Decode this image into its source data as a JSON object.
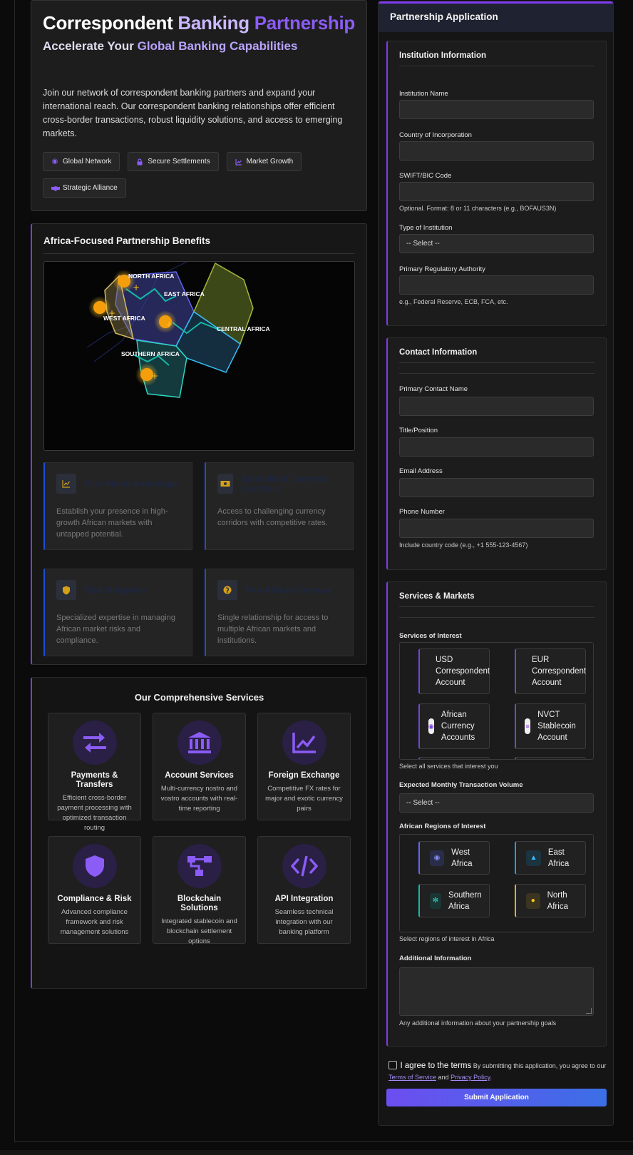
{
  "hero": {
    "title_w1": "Correspondent ",
    "title_w2": "Banking ",
    "title_w3": "Partnership",
    "subtitle_w1": "Accelerate Your ",
    "subtitle_w2": "Global Banking Capabilities",
    "description": "Join our network of correspondent banking partners and expand your international reach. Our correspondent banking relationships offer efficient cross-border transactions, robust liquidity solutions, and access to emerging markets.",
    "tags": [
      {
        "label": "Global Network",
        "icon": "globe-icon"
      },
      {
        "label": "Secure Settlements",
        "icon": "lock-icon"
      },
      {
        "label": "Market Growth",
        "icon": "chart-line-icon"
      },
      {
        "label": "Strategic Alliance",
        "icon": "handshake-icon"
      }
    ]
  },
  "benefits": {
    "title": "Africa-Focused Partnership Benefits",
    "map_labels": {
      "north": "NORTH AFRICA",
      "east": "EAST AFRICA",
      "west": "WEST AFRICA",
      "central": "CENTRAL AFRICA",
      "southern": "SOUTHERN AFRICA"
    },
    "cards": [
      {
        "title": "First-Mover Advantage",
        "text": "Establish your presence in high-growth African markets with untapped potential.",
        "icon": "chart-line-icon"
      },
      {
        "title": "Specialized Currency Corridors",
        "text": "Access to challenging currency corridors with competitive rates.",
        "icon": "money-bill-icon"
      },
      {
        "title": "Risk Mitigation",
        "text": "Specialized expertise in managing African market risks and compliance.",
        "icon": "shield-icon"
      },
      {
        "title": "Pan-African Gateway",
        "text": "Single relationship for access to multiple African markets and institutions.",
        "icon": "globe-africa-icon"
      }
    ]
  },
  "services": {
    "title": "Our Comprehensive Services",
    "items": [
      {
        "title": "Payments & Transfers",
        "text": "Efficient cross-border payment processing with optimized transaction routing"
      },
      {
        "title": "Account Services",
        "text": "Multi-currency nostro and vostro accounts with real-time reporting"
      },
      {
        "title": "Foreign Exchange",
        "text": "Competitive FX rates for major and exotic currency pairs"
      },
      {
        "title": "Compliance & Risk",
        "text": "Advanced compliance framework and risk management solutions"
      },
      {
        "title": "Blockchain Solutions",
        "text": "Integrated stablecoin and blockchain settlement options"
      },
      {
        "title": "API Integration",
        "text": "Seamless technical integration with our banking platform"
      }
    ]
  },
  "form": {
    "header": "Partnership Application",
    "institution": {
      "title": "Institution Information",
      "name_label": "Institution Name",
      "country_label": "Country of Incorporation",
      "swift_label": "SWIFT/BIC Code",
      "swift_hint": "Optional. Format: 8 or 11 characters (e.g., BOFAUS3N)",
      "type_label": "Type of Institution",
      "type_value": "-- Select --",
      "regulator_label": "Primary Regulatory Authority",
      "regulator_hint": "e.g., Federal Reserve, ECB, FCA, etc."
    },
    "contact": {
      "title": "Contact Information",
      "name_label": "Primary Contact Name",
      "title_label": "Title/Position",
      "email_label": "Email Address",
      "phone_label": "Phone Number",
      "phone_hint": "Include country code (e.g., +1 555-123-4567)"
    },
    "markets": {
      "title": "Services & Markets",
      "services_label": "Services of Interest",
      "service_options": [
        "USD Correspondent Account",
        "EUR Correspondent Account",
        "African Currency Accounts",
        "NVCT Stablecoin Account"
      ],
      "services_hint": "Select all services that interest you",
      "volume_label": "Expected Monthly Transaction Volume",
      "volume_value": "-- Select --",
      "regions_label": "African Regions of Interest",
      "regions": [
        {
          "label": "West Africa",
          "color": "#6366f1"
        },
        {
          "label": "East Africa",
          "color": "#0ea5e9"
        },
        {
          "label": "Southern Africa",
          "color": "#14b8a6"
        },
        {
          "label": "North Africa",
          "color": "#eab308"
        }
      ],
      "regions_hint": "Select regions of interest in Africa",
      "additional_label": "Additional Information",
      "additional_hint": "Any additional information about your partnership goals"
    },
    "agree_main": "I agree to the terms",
    "agree_text": "By submitting this application, you agree to our",
    "terms_link": "Terms of Service",
    "and_text": "and",
    "privacy_link": "Privacy Policy",
    "period": ".",
    "submit_label": "Submit Application"
  }
}
